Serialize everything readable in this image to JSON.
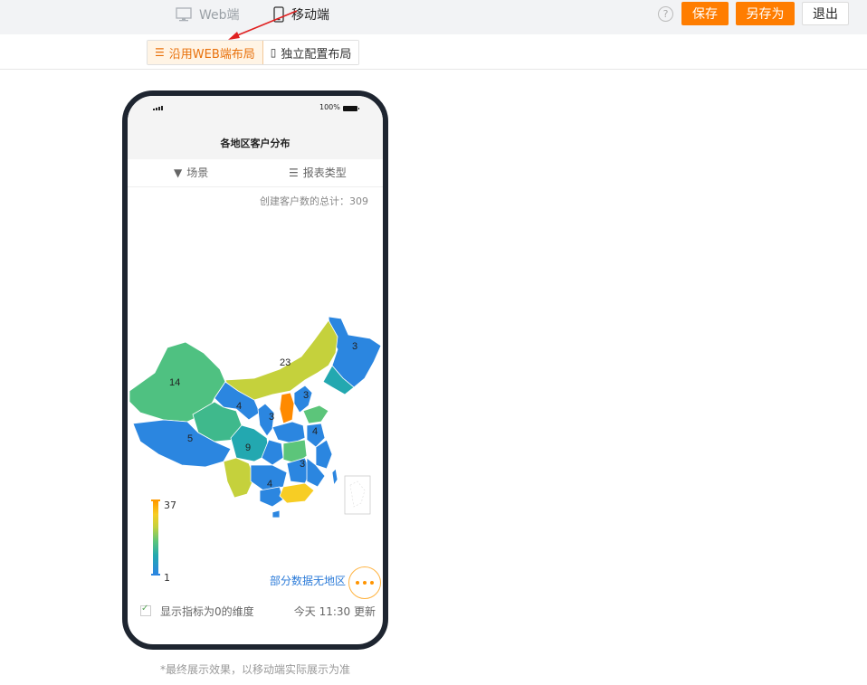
{
  "topbar": {
    "tabs": {
      "web": "Web端",
      "mobile": "移动端"
    },
    "help_icon": "?",
    "buttons": {
      "save": "保存",
      "save_as": "另存为",
      "exit": "退出"
    }
  },
  "layout_toggle": {
    "use_web": "沿用WEB端布局",
    "independent": "独立配置布局"
  },
  "phone": {
    "status": {
      "battery": "100%"
    },
    "report_title": "各地区客户分布",
    "filters": {
      "scene": "场景",
      "report_type": "报表类型"
    },
    "summary": "创建客户数的总计：309",
    "legend": {
      "max": "37",
      "min": "1"
    },
    "map_labels": [
      "14",
      "23",
      "3",
      "4",
      "3",
      "3",
      "5",
      "9",
      "4",
      "3",
      "4"
    ],
    "no_region_link": "部分数据无地区",
    "show_zero_label": "显示指标为0的维度",
    "updated": "今天 11:30 更新"
  },
  "footnote": "*最终展示效果，以移动端实际展示为准",
  "colors": {
    "accent": "#ff7d00",
    "map_scale": [
      "#2b86e0",
      "#23a8b0",
      "#5cc57a",
      "#c5d13c",
      "#f7cd24",
      "#ff9b00"
    ]
  }
}
